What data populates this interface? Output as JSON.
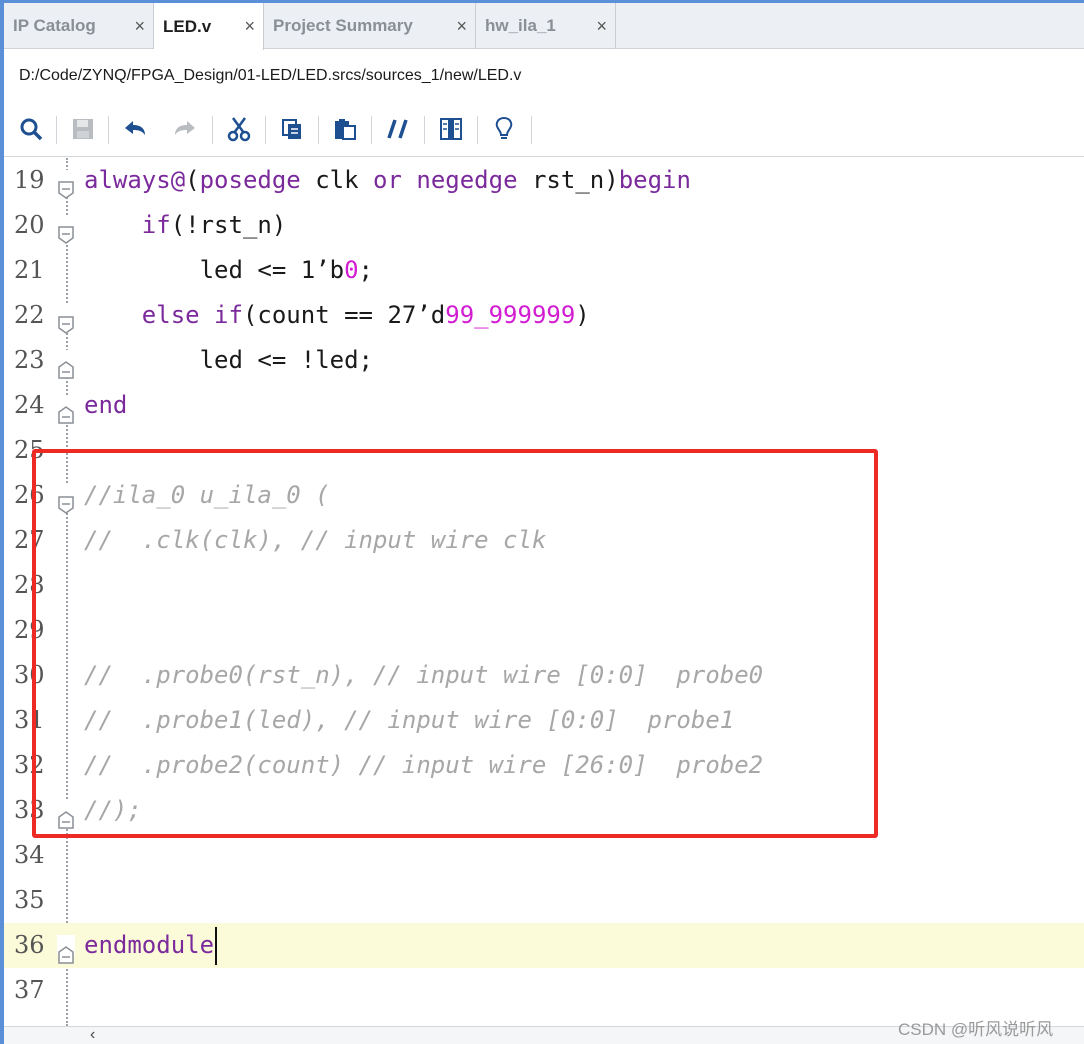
{
  "tabs": [
    {
      "label": "IP Catalog",
      "close": "×"
    },
    {
      "label": "LED.v",
      "close": "×"
    },
    {
      "label": "Project Summary",
      "close": "×"
    },
    {
      "label": "hw_ila_1",
      "close": "×"
    }
  ],
  "file_path": "D:/Code/ZYNQ/FPGA_Design/01-LED/LED.srcs/sources_1/new/LED.v",
  "toolbar_icons": [
    "search-icon",
    "save-icon",
    "undo-icon",
    "redo-icon",
    "cut-icon",
    "copy-icon",
    "paste-icon",
    "comment-icon",
    "format-icon",
    "lightbulb-icon"
  ],
  "lines": [
    {
      "n": "19",
      "segs": [
        [
          "kw",
          "always@"
        ],
        [
          "p",
          "("
        ],
        [
          "kw",
          "posedge"
        ],
        [
          "p",
          " clk "
        ],
        [
          "kw",
          "or"
        ],
        [
          "p",
          " "
        ],
        [
          "kw",
          "negedge"
        ],
        [
          "p",
          " rst_n)"
        ],
        [
          "kw",
          "begin"
        ]
      ]
    },
    {
      "n": "20",
      "segs": [
        [
          "p",
          "    "
        ],
        [
          "kw",
          "if"
        ],
        [
          "p",
          "(!rst_n)"
        ]
      ]
    },
    {
      "n": "21",
      "segs": [
        [
          "p",
          "        led <= 1’b"
        ],
        [
          "num",
          "0"
        ],
        [
          "p",
          ";"
        ]
      ]
    },
    {
      "n": "22",
      "segs": [
        [
          "p",
          "    "
        ],
        [
          "kw",
          "else if"
        ],
        [
          "p",
          "(count == 27’d"
        ],
        [
          "num",
          "99_999999"
        ],
        [
          "p",
          ")"
        ]
      ]
    },
    {
      "n": "23",
      "segs": [
        [
          "p",
          "        led <= !led;"
        ]
      ]
    },
    {
      "n": "24",
      "segs": [
        [
          "kw",
          "end"
        ]
      ]
    },
    {
      "n": "25",
      "segs": []
    },
    {
      "n": "26",
      "segs": [
        [
          "cm",
          "//ila_0 u_ila_0 ("
        ]
      ]
    },
    {
      "n": "27",
      "segs": [
        [
          "cm",
          "//  .clk(clk), // input wire clk"
        ]
      ]
    },
    {
      "n": "28",
      "segs": []
    },
    {
      "n": "29",
      "segs": []
    },
    {
      "n": "30",
      "segs": [
        [
          "cm",
          "//  .probe0(rst_n), // input wire [0:0]  probe0"
        ]
      ]
    },
    {
      "n": "31",
      "segs": [
        [
          "cm",
          "//  .probe1(led), // input wire [0:0]  probe1"
        ]
      ]
    },
    {
      "n": "32",
      "segs": [
        [
          "cm",
          "//  .probe2(count) // input wire [26:0]  probe2"
        ]
      ]
    },
    {
      "n": "33",
      "segs": [
        [
          "cm",
          "//);"
        ]
      ]
    },
    {
      "n": "34",
      "segs": []
    },
    {
      "n": "35",
      "segs": []
    },
    {
      "n": "36",
      "segs": [
        [
          "kw",
          "endmodule"
        ]
      ]
    },
    {
      "n": "37",
      "segs": []
    }
  ],
  "colors": {
    "keyword": "#7b2a9c",
    "number": "#d21cd2",
    "comment": "#a7a7a7",
    "highlight_box": "#ee2a24",
    "current_line": "#fcfbd9"
  },
  "scroll_arrow": "‹",
  "watermark": "CSDN @听风说听风"
}
